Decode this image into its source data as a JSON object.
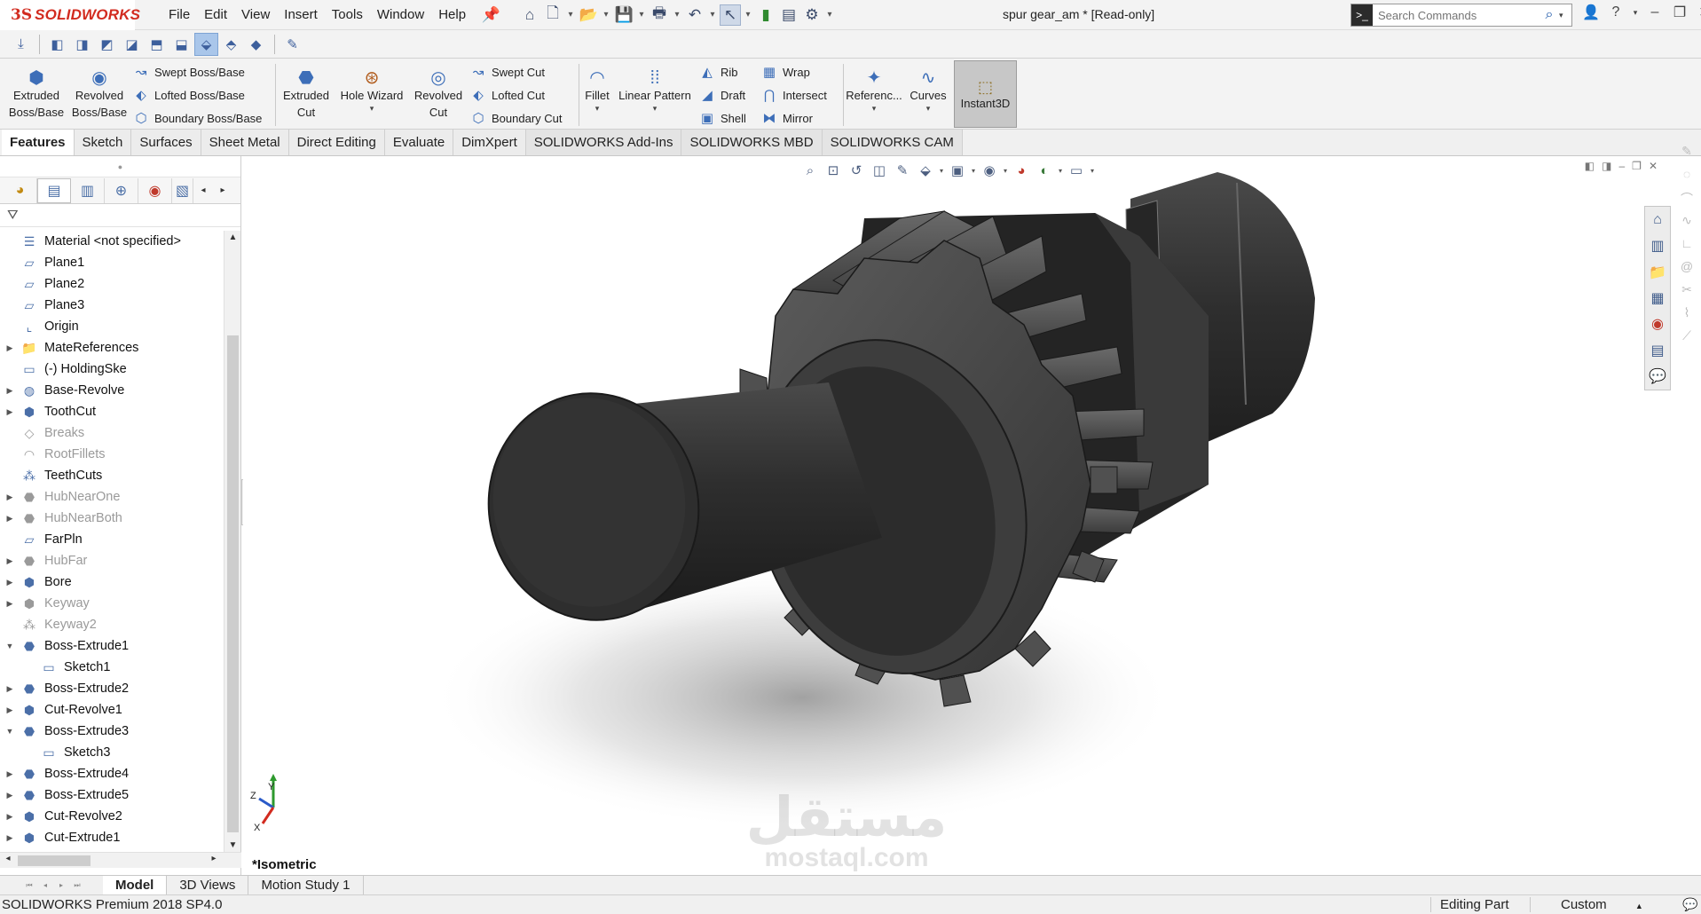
{
  "app": {
    "logo_ds": "3S",
    "logo_name": "SOLIDWORKS",
    "document_title": "spur gear_am * [Read-only]"
  },
  "menus": [
    "File",
    "Edit",
    "View",
    "Insert",
    "Tools",
    "Window",
    "Help"
  ],
  "search": {
    "placeholder": "Search Commands"
  },
  "command_manager": {
    "extruded_boss": "Extruded\nBoss/Base",
    "revolved_boss": "Revolved\nBoss/Base",
    "swept_boss": "Swept Boss/Base",
    "lofted_boss": "Lofted Boss/Base",
    "boundary_boss": "Boundary Boss/Base",
    "extruded_cut": "Extruded\nCut",
    "hole_wizard": "Hole Wizard",
    "revolved_cut": "Revolved\nCut",
    "swept_cut": "Swept Cut",
    "lofted_cut": "Lofted Cut",
    "boundary_cut": "Boundary Cut",
    "fillet": "Fillet",
    "linear_pattern": "Linear Pattern",
    "rib": "Rib",
    "draft": "Draft",
    "shell": "Shell",
    "wrap": "Wrap",
    "intersect": "Intersect",
    "mirror": "Mirror",
    "reference": "Referenc...",
    "curves": "Curves",
    "instant3d": "Instant3D"
  },
  "tabs": [
    "Features",
    "Sketch",
    "Surfaces",
    "Sheet Metal",
    "Direct Editing",
    "Evaluate",
    "DimXpert",
    "SOLIDWORKS Add-Ins",
    "SOLIDWORKS MBD",
    "SOLIDWORKS CAM"
  ],
  "feature_tree": [
    {
      "label": "Material <not specified>",
      "icon": "material-icon",
      "expand": "",
      "dim": false,
      "child": false
    },
    {
      "label": "Plane1",
      "icon": "plane-icon",
      "expand": "",
      "dim": false,
      "child": false
    },
    {
      "label": "Plane2",
      "icon": "plane-icon",
      "expand": "",
      "dim": false,
      "child": false
    },
    {
      "label": "Plane3",
      "icon": "plane-icon",
      "expand": "",
      "dim": false,
      "child": false
    },
    {
      "label": "Origin",
      "icon": "origin-icon",
      "expand": "",
      "dim": false,
      "child": false
    },
    {
      "label": "MateReferences",
      "icon": "folder-icon",
      "expand": "right",
      "dim": false,
      "child": false
    },
    {
      "label": "(-) HoldingSke",
      "icon": "sketch-icon",
      "expand": "",
      "dim": false,
      "child": false
    },
    {
      "label": "Base-Revolve",
      "icon": "revolve-icon",
      "expand": "right",
      "dim": false,
      "child": false
    },
    {
      "label": "ToothCut",
      "icon": "cut-icon",
      "expand": "right",
      "dim": false,
      "child": false
    },
    {
      "label": "Breaks",
      "icon": "feature-icon",
      "expand": "",
      "dim": true,
      "child": false
    },
    {
      "label": "RootFillets",
      "icon": "fillet-icon",
      "expand": "",
      "dim": true,
      "child": false
    },
    {
      "label": "TeethCuts",
      "icon": "pattern-icon",
      "expand": "",
      "dim": false,
      "child": false
    },
    {
      "label": "HubNearOne",
      "icon": "extrude-icon",
      "expand": "right",
      "dim": true,
      "child": false
    },
    {
      "label": "HubNearBoth",
      "icon": "extrude-icon",
      "expand": "right",
      "dim": true,
      "child": false
    },
    {
      "label": "FarPln",
      "icon": "plane-icon",
      "expand": "",
      "dim": false,
      "child": false
    },
    {
      "label": "HubFar",
      "icon": "extrude-icon",
      "expand": "right",
      "dim": true,
      "child": false
    },
    {
      "label": "Bore",
      "icon": "cut-icon",
      "expand": "right",
      "dim": false,
      "child": false
    },
    {
      "label": "Keyway",
      "icon": "cut-icon",
      "expand": "right",
      "dim": true,
      "child": false
    },
    {
      "label": "Keyway2",
      "icon": "pattern-icon",
      "expand": "",
      "dim": true,
      "child": false
    },
    {
      "label": "Boss-Extrude1",
      "icon": "extrude-icon",
      "expand": "down",
      "dim": false,
      "child": false
    },
    {
      "label": "Sketch1",
      "icon": "sketch-icon",
      "expand": "",
      "dim": false,
      "child": true
    },
    {
      "label": "Boss-Extrude2",
      "icon": "extrude-icon",
      "expand": "right",
      "dim": false,
      "child": false
    },
    {
      "label": "Cut-Revolve1",
      "icon": "cut-icon",
      "expand": "right",
      "dim": false,
      "child": false
    },
    {
      "label": "Boss-Extrude3",
      "icon": "extrude-icon",
      "expand": "down",
      "dim": false,
      "child": false
    },
    {
      "label": "Sketch3",
      "icon": "sketch-icon",
      "expand": "",
      "dim": false,
      "child": true
    },
    {
      "label": "Boss-Extrude4",
      "icon": "extrude-icon",
      "expand": "right",
      "dim": false,
      "child": false
    },
    {
      "label": "Boss-Extrude5",
      "icon": "extrude-icon",
      "expand": "right",
      "dim": false,
      "child": false
    },
    {
      "label": "Cut-Revolve2",
      "icon": "cut-icon",
      "expand": "right",
      "dim": false,
      "child": false
    },
    {
      "label": "Cut-Extrude1",
      "icon": "cut-icon",
      "expand": "right",
      "dim": false,
      "child": false
    }
  ],
  "viewport": {
    "view_name": "*Isometric",
    "triad_axes": [
      "Z",
      "Y",
      "X"
    ],
    "watermark_ar": "مستقل",
    "watermark_en": "mostaql.com"
  },
  "bottom_tabs": [
    "Model",
    "3D Views",
    "Motion Study 1"
  ],
  "status": {
    "product": "SOLIDWORKS Premium 2018 SP4.0",
    "mode": "Editing Part",
    "units": "Custom"
  },
  "colors": {
    "accent_red": "#d22b1f",
    "gear_dark": "#2b2b2b",
    "gear_light": "#5a5a5a",
    "active_tool": "#a9c6ea"
  }
}
